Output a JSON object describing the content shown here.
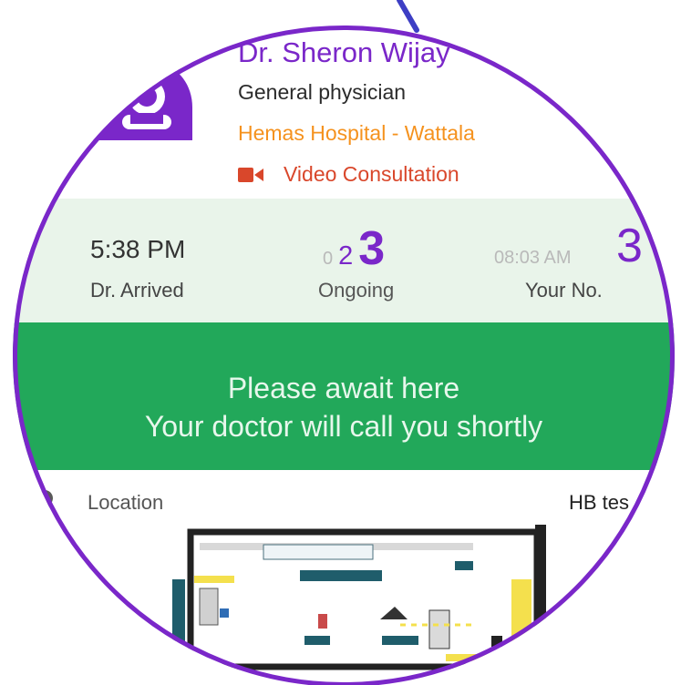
{
  "doctor": {
    "name": "Dr. Sheron Wijay",
    "specialty": "General physician",
    "hospital": "Hemas Hospital - Wattala",
    "consultation_type": "Video Consultation"
  },
  "status": {
    "arrival_time": "5:38 PM",
    "arrival_label": "Dr. Arrived",
    "queue_prev": "0",
    "queue_mid": "2",
    "queue_current": "3",
    "ongoing_label": "Ongoing",
    "appointment_time": "08:03 AM",
    "your_number": "3",
    "your_number_label": "Your No."
  },
  "banner": {
    "line1": "Please await here",
    "line2": "Your doctor will call you shortly"
  },
  "location": {
    "label": "Location",
    "value": "HB tes"
  },
  "colors": {
    "accent": "#7a27c9",
    "hospital": "#f5921e",
    "video": "#d9472b",
    "status_band": "#e9f4ea",
    "banner": "#22a85a",
    "connector": "#3d3ec4"
  },
  "icons": {
    "avatar": "doctor-avatar-icon",
    "video": "video-camera-icon",
    "location": "location-pin-icon"
  }
}
